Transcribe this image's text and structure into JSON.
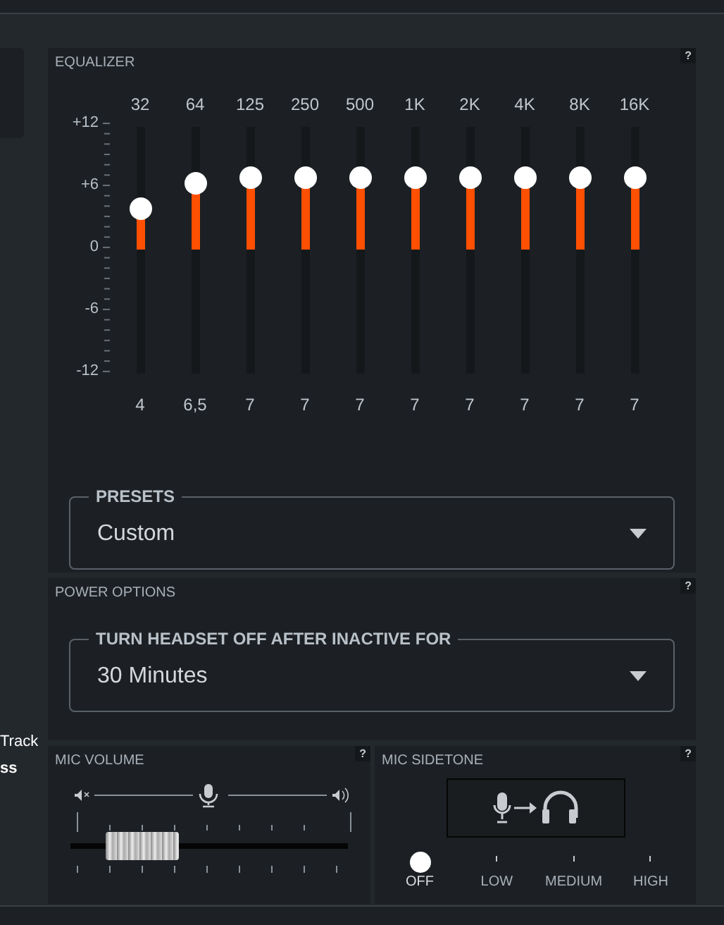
{
  "sidebar": {
    "texts": [
      "Track",
      "ss"
    ]
  },
  "equalizer": {
    "title": "EQUALIZER",
    "help": "?",
    "scale": [
      "+12",
      "+6",
      "0",
      "-6",
      "-12"
    ],
    "bands": [
      {
        "frequency": "32",
        "value": "4",
        "level": 0.667
      },
      {
        "frequency": "64",
        "value": "6,5",
        "level": 0.771
      },
      {
        "frequency": "125",
        "value": "7",
        "level": 0.792
      },
      {
        "frequency": "250",
        "value": "7",
        "level": 0.792
      },
      {
        "frequency": "500",
        "value": "7",
        "level": 0.792
      },
      {
        "frequency": "1K",
        "value": "7",
        "level": 0.792
      },
      {
        "frequency": "2K",
        "value": "7",
        "level": 0.792
      },
      {
        "frequency": "4K",
        "value": "7",
        "level": 0.792
      },
      {
        "frequency": "8K",
        "value": "7",
        "level": 0.792
      },
      {
        "frequency": "16K",
        "value": "7",
        "level": 0.792
      }
    ],
    "presets": {
      "label": "PRESETS",
      "value": "Custom"
    }
  },
  "power_options": {
    "title": "POWER OPTIONS",
    "help": "?",
    "select": {
      "label": "TURN HEADSET OFF AFTER INACTIVE FOR",
      "value": "30 Minutes"
    }
  },
  "mic_volume": {
    "title": "MIC VOLUME",
    "help": "?",
    "level": 0.26
  },
  "mic_sidetone": {
    "title": "MIC SIDETONE",
    "help": "?",
    "options": [
      {
        "label": "OFF",
        "selected": true
      },
      {
        "label": "LOW",
        "selected": false
      },
      {
        "label": "MEDIUM",
        "selected": false
      },
      {
        "label": "HIGH",
        "selected": false
      }
    ]
  }
}
